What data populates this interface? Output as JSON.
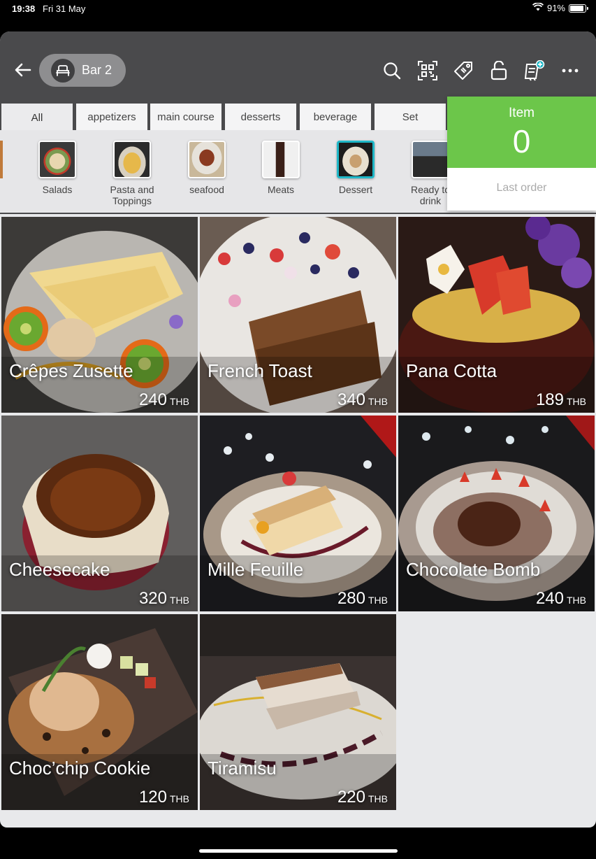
{
  "status": {
    "time": "19:38",
    "date": "Fri 31 May",
    "battery": "91%",
    "battery_level": 0.91
  },
  "header": {
    "table_name": "Bar 2",
    "icons": [
      "search-icon",
      "qr-code-icon",
      "tag-icon",
      "unlock-icon",
      "order-add-icon",
      "more-icon"
    ]
  },
  "tabs": [
    {
      "label": "All",
      "active": true
    },
    {
      "label": "appetizers"
    },
    {
      "label": "main course"
    },
    {
      "label": "desserts"
    },
    {
      "label": "beverage"
    },
    {
      "label": "Set"
    }
  ],
  "subcategories": [
    {
      "label": "Salads"
    },
    {
      "label": "Pasta and Toppings"
    },
    {
      "label": "seafood"
    },
    {
      "label": "Meats"
    },
    {
      "label": "Dessert",
      "active": true
    },
    {
      "label": "Ready to drink"
    }
  ],
  "counter": {
    "title": "Item",
    "value": "0",
    "last_order": "Last order"
  },
  "menu_items": [
    {
      "name": "Crêpes Zusette",
      "price": "240",
      "currency": "THB"
    },
    {
      "name": "French Toast",
      "price": "340",
      "currency": "THB"
    },
    {
      "name": "Pana Cotta",
      "price": "189",
      "currency": "THB"
    },
    {
      "name": "Cheesecake",
      "price": "320",
      "currency": "THB"
    },
    {
      "name": "Mille Feuille",
      "price": "280",
      "currency": "THB"
    },
    {
      "name": "Chocolate Bomb",
      "price": "240",
      "currency": "THB"
    },
    {
      "name": "Choc’chip Cookie",
      "price": "120",
      "currency": "THB"
    },
    {
      "name": "Tiramisu",
      "price": "220",
      "currency": "THB"
    }
  ],
  "colors": {
    "topbar": "#4a4a4c",
    "counter_green": "#6cc64a",
    "active_outline": "#1fb8c8"
  }
}
